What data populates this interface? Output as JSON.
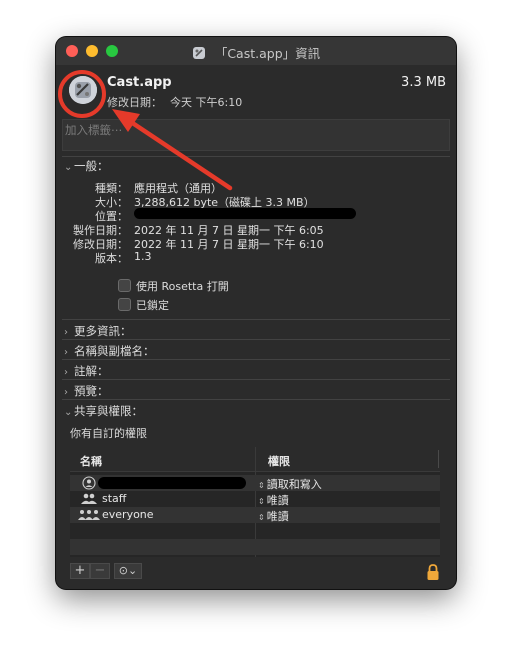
{
  "window": {
    "title": "「Cast.app」資訊"
  },
  "header": {
    "app_name": "Cast.app",
    "size": "3.3 MB",
    "modified_label": "修改日期：",
    "modified_value": "今天 下午6:10"
  },
  "tags": {
    "placeholder": "加入標籤⋯"
  },
  "general": {
    "title": "一般：",
    "rows": [
      {
        "label": "種類：",
        "value": "應用程式（通用）"
      },
      {
        "label": "大小：",
        "value": "3,288,612 byte（磁碟上 3.3 MB）"
      },
      {
        "label": "位置：",
        "value": ""
      },
      {
        "label": "製作日期：",
        "value": "2022 年 11 月 7 日 星期一 下午 6:05"
      },
      {
        "label": "修改日期：",
        "value": "2022 年 11 月 7 日 星期一 下午 6:10"
      },
      {
        "label": "版本：",
        "value": "1.3"
      }
    ],
    "rosetta_label": "使用 Rosetta 打開",
    "locked_label": "已鎖定"
  },
  "sections": {
    "more_info": "更多資訊：",
    "name_ext": "名稱與副檔名：",
    "comments": "註解：",
    "preview": "預覽：",
    "sharing": "共享與權限："
  },
  "permissions": {
    "caption": "你有自訂的權限",
    "col_name": "名稱",
    "col_priv": "權限",
    "rows": [
      {
        "name": "",
        "priv": "讀取和寫入",
        "icon": "single-user-icon"
      },
      {
        "name": "staff",
        "priv": "唯讀",
        "icon": "group-icon"
      },
      {
        "name": "everyone",
        "priv": "唯讀",
        "icon": "everyone-icon"
      }
    ]
  },
  "toolbar": {
    "add": "+",
    "remove": "−",
    "action": "⊙⌄"
  },
  "colors": {
    "annotation": "#e53a2a",
    "window_bg": "#2b2b2b"
  }
}
